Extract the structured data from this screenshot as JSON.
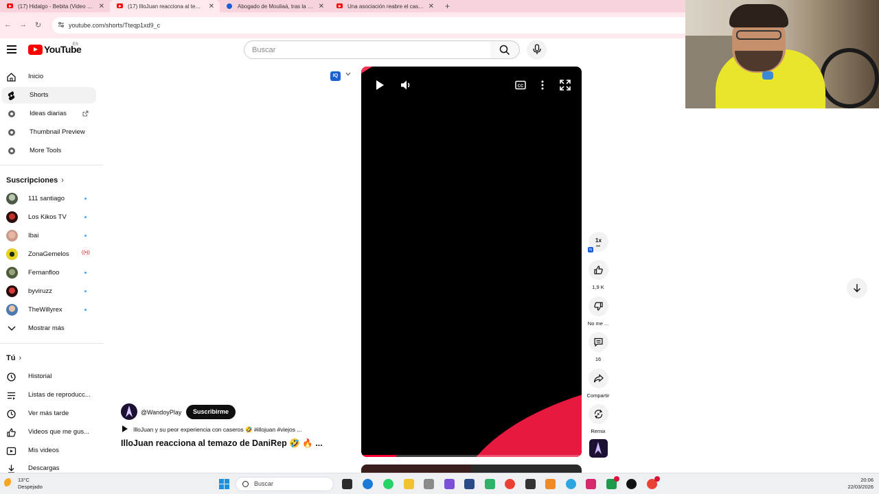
{
  "browser": {
    "tabs": [
      {
        "label": "(17) Hidalgo - Bebita (Video of...",
        "favicon": "youtube-icon",
        "active": false
      },
      {
        "label": "(17) IlloJuan reacciona al temaz...",
        "favicon": "youtube-icon",
        "active": true
      },
      {
        "label": "Abogado de Mouliaá, tras la pe...",
        "favicon": "news-icon",
        "active": false
      },
      {
        "label": "Una asociación reabre el caso c...",
        "favicon": "youtube-icon",
        "active": false
      }
    ],
    "new_tab": "+",
    "url": "youtube.com/shorts/Tteqp1xd9_c"
  },
  "youtube": {
    "logo_text": "YouTube",
    "region": "ES",
    "search_placeholder": "Buscar",
    "sidebar": {
      "main": [
        {
          "label": "Inicio",
          "icon": "home-icon"
        },
        {
          "label": "Shorts",
          "icon": "shorts-icon",
          "active": true
        },
        {
          "label": "Ideas diarias",
          "icon": "extension-icon",
          "external": true
        },
        {
          "label": "Thumbnail Preview",
          "icon": "extension-icon"
        },
        {
          "label": "More Tools",
          "icon": "extension-icon"
        }
      ],
      "subscriptions_title": "Suscripciones",
      "subscriptions": [
        {
          "label": "111 santiago",
          "indicator": "new"
        },
        {
          "label": "Los Kikos TV",
          "indicator": "new"
        },
        {
          "label": "Ibai",
          "indicator": "new"
        },
        {
          "label": "ZonaGemelos",
          "indicator": "live"
        },
        {
          "label": "Fernanfloo",
          "indicator": "new"
        },
        {
          "label": "byviruzz",
          "indicator": "new"
        },
        {
          "label": "TheWillyrex",
          "indicator": "new"
        },
        {
          "label": "Mostrar más",
          "indicator": "none"
        }
      ],
      "you_title": "Tú",
      "you": [
        {
          "label": "Historial",
          "icon": "history-icon"
        },
        {
          "label": "Listas de reproducc...",
          "icon": "playlist-icon"
        },
        {
          "label": "Ver más tarde",
          "icon": "clock-icon"
        },
        {
          "label": "Videos que me gus...",
          "icon": "like-icon"
        },
        {
          "label": "Mis videos",
          "icon": "video-icon"
        },
        {
          "label": "Descargas",
          "icon": "download-icon"
        }
      ]
    },
    "short": {
      "channel_handle": "@WandoyPlay",
      "subscribe_label": "Suscribirme",
      "music_line": "IlloJuan y su peor experiencia con caseros 🤣 #illojuan #viejos ...",
      "title": "IlloJuan reacciona al temazo de DaniRep 🤣 🔥 ...",
      "progress": 0.16
    },
    "actions": {
      "speed": "1x",
      "likes": "1,9 K",
      "dislike": "No me ...",
      "comments": "16",
      "share": "Compartir",
      "remix": "Remix"
    }
  },
  "taskbar": {
    "weather_temp": "13°C",
    "weather_desc": "Despejado",
    "search_label": "Buscar",
    "time": "20:06",
    "date": "22/03/2026"
  },
  "colors": {
    "youtube_red": "#ff0000",
    "tabstrip": "#f7d4dc",
    "player_accent": "#e8193f"
  }
}
